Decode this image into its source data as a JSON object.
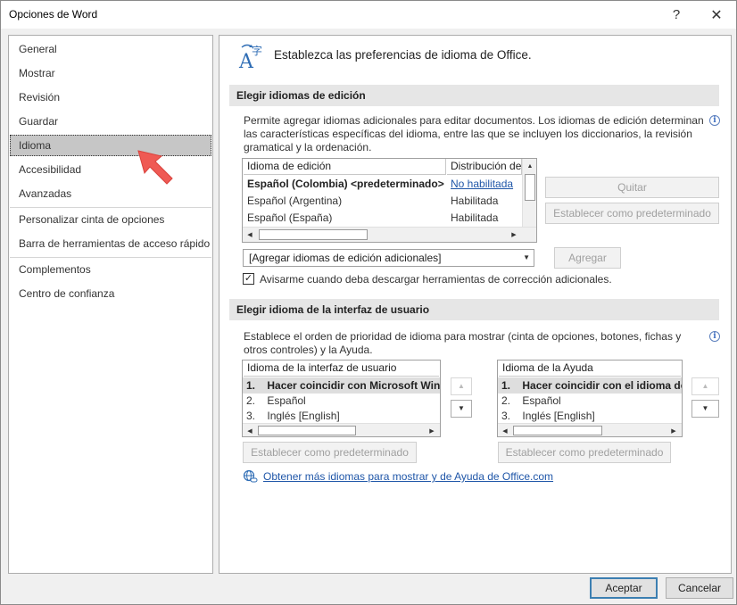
{
  "window": {
    "title": "Opciones de Word",
    "help_glyph": "?",
    "close_glyph": "✕"
  },
  "nav": {
    "items": [
      {
        "label": "General"
      },
      {
        "label": "Mostrar"
      },
      {
        "label": "Revisión"
      },
      {
        "label": "Guardar"
      },
      {
        "label": "Idioma",
        "selected": true
      },
      {
        "label": "Accesibilidad"
      },
      {
        "label": "Avanzadas"
      },
      {
        "label": "Personalizar cinta de opciones"
      },
      {
        "label": "Barra de herramientas de acceso rápido"
      },
      {
        "label": "Complementos"
      },
      {
        "label": "Centro de confianza"
      }
    ]
  },
  "header": {
    "text": "Establezca las preferencias de idioma de Office.",
    "icon": "language-icon"
  },
  "editing": {
    "section_title": "Elegir idiomas de edición",
    "description": "Permite agregar idiomas adicionales para editar documentos. Los idiomas de edición determinan las características específicas del idioma, entre las que se incluyen los diccionarios, la revisión gramatical y la ordenación.",
    "columns": [
      "Idioma de edición",
      "Distribución de"
    ],
    "rows": [
      {
        "language": "Español (Colombia) <predeterminado>",
        "status": "No habilitada",
        "is_default": true,
        "status_is_link": true
      },
      {
        "language": "Español (Argentina)",
        "status": "Habilitada"
      },
      {
        "language": "Español (España)",
        "status": "Habilitada"
      }
    ],
    "remove_button": "Quitar",
    "set_default_button": "Establecer como predeterminado",
    "add_dropdown_value": "[Agregar idiomas de edición adicionales]",
    "add_button": "Agregar",
    "notify_checkbox_label": "Avisarme cuando deba descargar herramientas de corrección adicionales.",
    "notify_checked": true
  },
  "ui_language": {
    "section_title": "Elegir idioma de la interfaz de usuario",
    "description": "Establece el orden de prioridad de idioma para mostrar (cinta de opciones, botones, fichas y otros controles) y la Ayuda.",
    "display_list": {
      "header": "Idioma de la interfaz de usuario",
      "items": [
        {
          "num": "1.",
          "label": "Hacer coincidir con Microsoft Wind"
        },
        {
          "num": "2.",
          "label": "Español"
        },
        {
          "num": "3.",
          "label": "Inglés [English]"
        }
      ],
      "set_default_button": "Establecer como predeterminado"
    },
    "help_list": {
      "header": "Idioma de la Ayuda",
      "items": [
        {
          "num": "1.",
          "label": "Hacer coincidir con el idioma de"
        },
        {
          "num": "2.",
          "label": "Español"
        },
        {
          "num": "3.",
          "label": "Inglés [English]"
        }
      ],
      "set_default_button": "Establecer como predeterminado"
    },
    "more_link": "Obtener más idiomas para mostrar y de Ayuda de Office.com"
  },
  "footer": {
    "ok_button": "Aceptar",
    "cancel_button": "Cancelar"
  },
  "colors": {
    "accent": "#3c7fb1",
    "link": "#1f56a8",
    "pointer_arrow": "#ef5a54"
  }
}
